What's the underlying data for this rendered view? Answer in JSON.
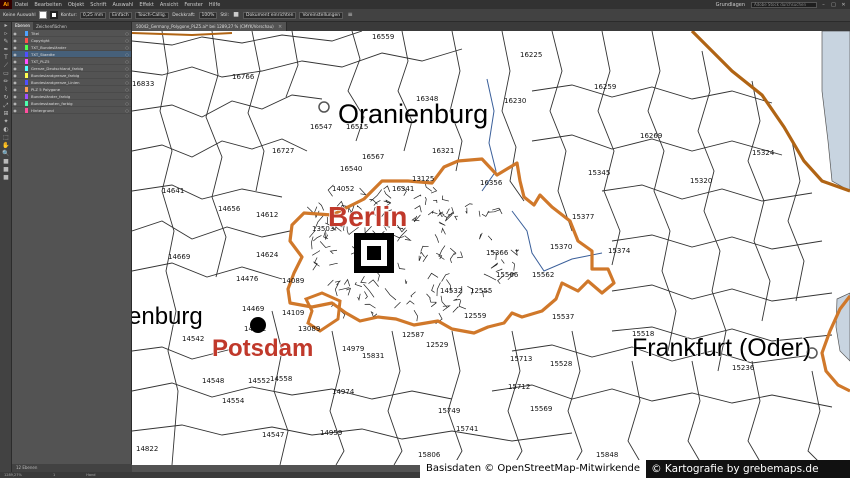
{
  "menubar": {
    "logo": "Ai",
    "items": [
      "Datei",
      "Bearbeiten",
      "Objekt",
      "Schrift",
      "Auswahl",
      "Effekt",
      "Ansicht",
      "Fenster",
      "Hilfe"
    ],
    "workspace": "Grundlagen",
    "search_placeholder": "Adobe Stock durchsuchen"
  },
  "control_bar": {
    "selection": "Keine Auswahl",
    "stroke_label": "Kontur:",
    "stroke_value": "0,25 mm",
    "brush_label": "Einfach",
    "style_label": "Touch-Callig.",
    "opacity_label": "Deckkraft:",
    "opacity_value": "100%",
    "style_label2": "Stil:",
    "doc_setup": "Dokument einrichten",
    "prefs": "Voreinstellungen"
  },
  "layers_panel": {
    "tabs": [
      "Ebenen",
      "Zeichenflächen"
    ],
    "layers": [
      {
        "name": "Titel",
        "color": "#4fa3ff"
      },
      {
        "name": "Copyright",
        "color": "#ff4f4f"
      },
      {
        "name": "TXT_Bundesländer",
        "color": "#4fff4f"
      },
      {
        "name": "TXT_Staedte",
        "color": "#4f4fff",
        "selected": true
      },
      {
        "name": "TXT_PLZ5",
        "color": "#ff4fff"
      },
      {
        "name": "Grenze_Deutschland_farbig",
        "color": "#4fffff"
      },
      {
        "name": "Bundeslandgrenze_farbig",
        "color": "#ffff4f"
      },
      {
        "name": "Bundeslandgrenze_Linien",
        "color": "#4f4fff"
      },
      {
        "name": "PLZ 5 Polygone",
        "color": "#ff9f4f"
      },
      {
        "name": "Bundesländer_farbig",
        "color": "#9f4fff"
      },
      {
        "name": "Bundesstaaten_farbig",
        "color": "#4fffaf"
      },
      {
        "name": "Hintergrund",
        "color": "#ff4f9f"
      }
    ],
    "footer": "12 Ebenen"
  },
  "document_tab": {
    "title": "50042_Germany_Polygone_PLZ5.ai* bei 1289,27 % (CMYK/Vorschau)"
  },
  "status_bar": {
    "zoom": "1289,27%",
    "artboard": "1",
    "tool": "Hand"
  },
  "map": {
    "cities": [
      {
        "name": "Oranienburg",
        "kind": "town"
      },
      {
        "name": "Berlin",
        "kind": "capital"
      },
      {
        "name": "Potsdam",
        "kind": "state-capital"
      },
      {
        "name": "Frankfurt (Oder)",
        "kind": "town"
      },
      {
        "name": "enburg",
        "kind": "town-cut"
      }
    ],
    "postcodes": [
      "16559",
      "16766",
      "16225",
      "16833",
      "16515",
      "16230",
      "16259",
      "16348",
      "16269",
      "16547",
      "16727",
      "16321",
      "16567",
      "16540",
      "15324",
      "14641",
      "13125",
      "16356",
      "15345",
      "14656",
      "16341",
      "15320",
      "14612",
      "15377",
      "15370",
      "15374",
      "14669",
      "14624",
      "15366",
      "14476",
      "14089",
      "15566",
      "15562",
      "14469",
      "14109",
      "15537",
      "14542",
      "14532",
      "14979",
      "15518",
      "15831",
      "15528",
      "15236",
      "14548",
      "14552",
      "14558",
      "15713",
      "14554",
      "14974",
      "15712",
      "15749",
      "15569",
      "14547",
      "14959",
      "15741",
      "14822",
      "15806",
      "15848",
      "12529",
      "12559",
      "12555",
      "12587",
      "14532",
      "13089",
      "14052",
      "13503"
    ],
    "colors": {
      "boundary_orange": "#d0782a",
      "berlin_red": "#c0392b",
      "lines": "#333333",
      "river": "#3a5f9a",
      "water": "#c8d4e0"
    }
  },
  "attribution": {
    "left": "Basisdaten © OpenStreetMap-Mitwirkende",
    "right": "© Kartografie by grebemaps.de"
  }
}
